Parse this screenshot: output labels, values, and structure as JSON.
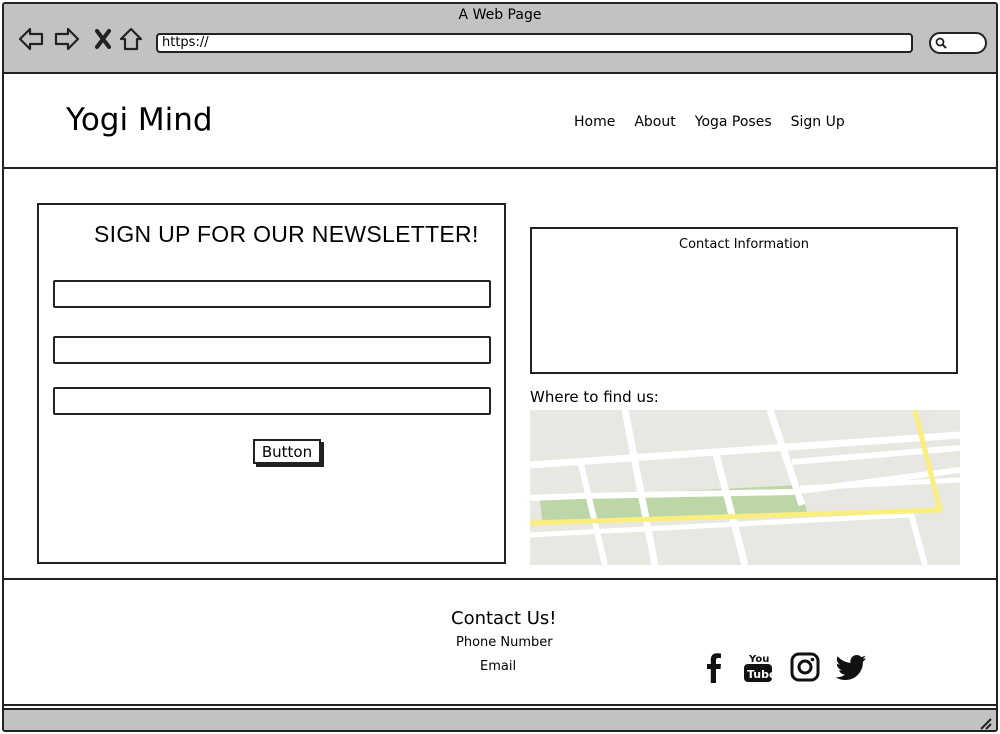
{
  "browser": {
    "title": "A Web Page",
    "url": "https://",
    "icons": [
      "back-arrow-icon",
      "forward-arrow-icon",
      "close-icon",
      "home-icon",
      "search-icon"
    ]
  },
  "header": {
    "logo": "Yogi Mind",
    "nav": [
      "Home",
      "About",
      "Yoga Poses",
      "Sign Up"
    ]
  },
  "newsletter": {
    "title": "SIGN UP FOR OUR NEWSLETTER!",
    "fields": [
      "",
      "",
      ""
    ],
    "button_label": "Button"
  },
  "contact_info": {
    "title": "Contact Information"
  },
  "map": {
    "heading": "Where to find us:",
    "colors": {
      "land": "#e9e7e2",
      "road": "#ffffff",
      "highway": "#f9ee7e",
      "park": "#bcd6a8"
    }
  },
  "footer": {
    "title": "Contact Us!",
    "phone": "Phone Number",
    "email": "Email",
    "social_icons": [
      "facebook-icon",
      "youtube-icon",
      "instagram-icon",
      "twitter-icon"
    ]
  }
}
